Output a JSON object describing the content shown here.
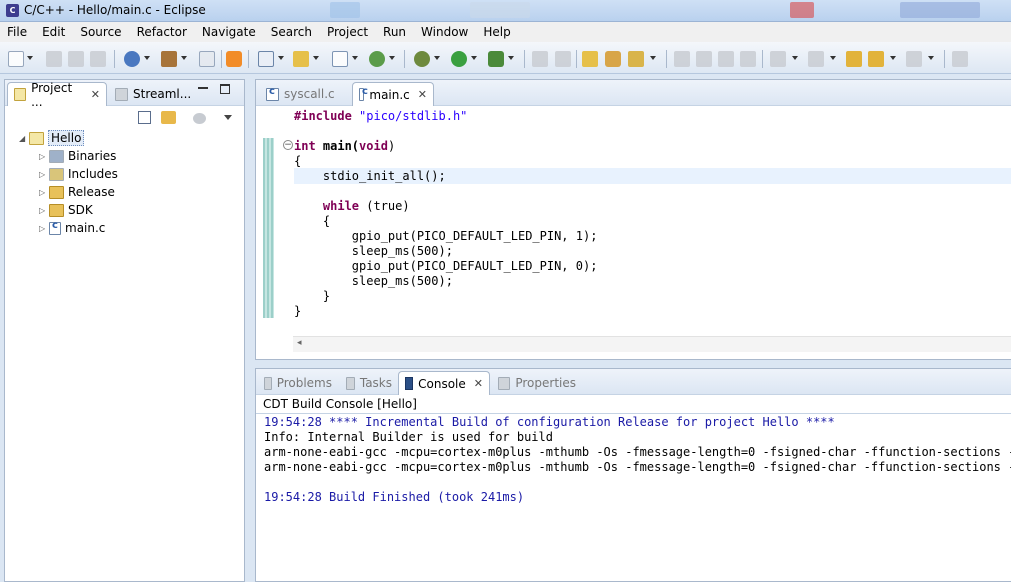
{
  "window": {
    "title": "C/C++ - Hello/main.c - Eclipse"
  },
  "menu": [
    "File",
    "Edit",
    "Source",
    "Refactor",
    "Navigate",
    "Search",
    "Project",
    "Run",
    "Window",
    "Help"
  ],
  "left_panel": {
    "tabs": [
      {
        "label": "Project ...",
        "icon": "project-explorer-icon",
        "close": "✕"
      },
      {
        "label": "Streaml...",
        "icon": "streamline-icon"
      }
    ],
    "tree": {
      "root": "Hello",
      "children": [
        "Binaries",
        "Includes",
        "Release",
        "SDK",
        "main.c"
      ]
    }
  },
  "editor": {
    "tabs": [
      {
        "label": "syscall.c",
        "icon": "c-file-icon"
      },
      {
        "label": "main.c",
        "icon": "c-file-icon",
        "close": "✕"
      }
    ],
    "code": {
      "l1_pp": "#include ",
      "l1_str": "\"pico/stdlib.h\"",
      "l2_kw": "int",
      "l2_rest": " main(",
      "l2_void": "void",
      "l2_close": ")",
      "l3": "{",
      "l4": "    stdio_init_all();",
      "l5_kw": "while",
      "l5_rest": " (true)",
      "l6": "    {",
      "l7": "        gpio_put(PICO_DEFAULT_LED_PIN, 1);",
      "l8": "        sleep_ms(500);",
      "l9": "        gpio_put(PICO_DEFAULT_LED_PIN, 0);",
      "l10": "        sleep_ms(500);",
      "l11": "    }",
      "l12": "}"
    }
  },
  "bottom_panel": {
    "tabs": [
      {
        "label": "Problems",
        "icon": "problems-icon"
      },
      {
        "label": "Tasks",
        "icon": "tasks-icon"
      },
      {
        "label": "Console",
        "icon": "console-icon",
        "close": "✕"
      },
      {
        "label": "Properties",
        "icon": "properties-icon"
      }
    ],
    "console_title": "CDT Build Console [Hello]",
    "lines": [
      "19:54:28 **** Incremental Build of configuration Release for project Hello ****",
      "Info: Internal Builder is used for build",
      "arm-none-eabi-gcc -mcpu=cortex-m0plus -mthumb -Os -fmessage-length=0 -fsigned-char -ffunction-sections -fdat",
      "arm-none-eabi-gcc -mcpu=cortex-m0plus -mthumb -Os -fmessage-length=0 -fsigned-char -ffunction-sections -fdat",
      "",
      "19:54:28 Build Finished (took 241ms)"
    ]
  },
  "colors": {
    "keyword": "#7f0055",
    "string": "#2a00ff",
    "console_info": "#1a1aa6"
  }
}
